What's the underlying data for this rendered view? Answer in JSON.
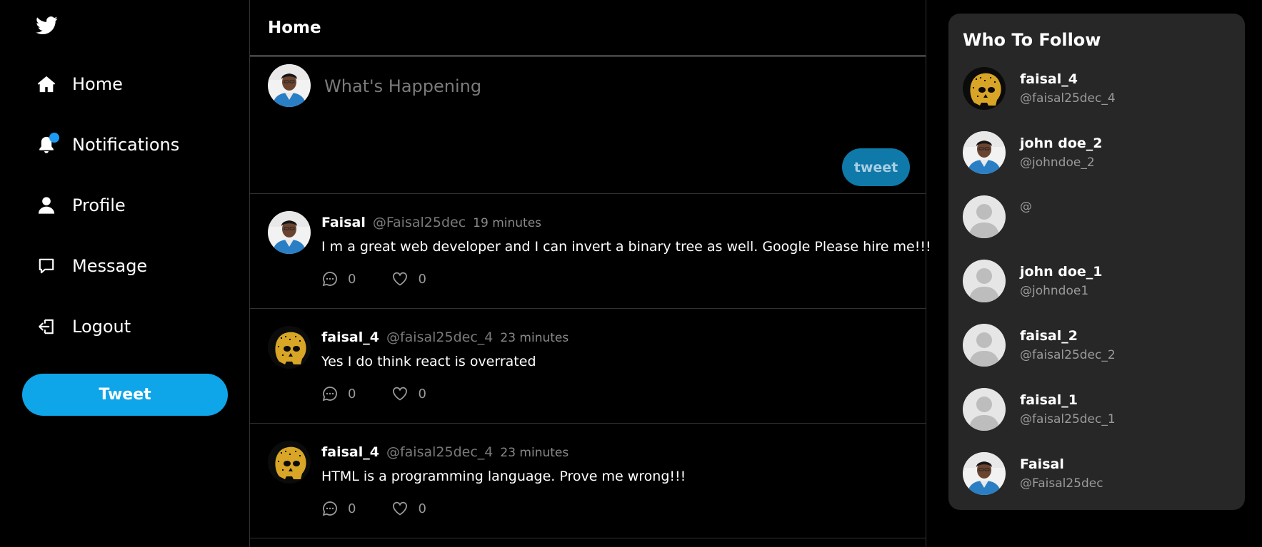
{
  "nav": {
    "logo": "twitter-bird-icon",
    "items": [
      {
        "label": "Home",
        "icon": "home-icon"
      },
      {
        "label": "Notifications",
        "icon": "bell-icon"
      },
      {
        "label": "Profile",
        "icon": "user-icon"
      },
      {
        "label": "Message",
        "icon": "message-icon"
      },
      {
        "label": "Logout",
        "icon": "logout-icon"
      }
    ],
    "tweet_button": "Tweet"
  },
  "main": {
    "title": "Home",
    "compose": {
      "placeholder": "What's Happening",
      "submit_label": "tweet"
    },
    "tweets": [
      {
        "name": "Faisal",
        "handle": "@Faisal25dec",
        "time": "19 minutes",
        "text": "I m a great web developer and I can invert a binary tree as well. Google Please hire me!!!",
        "comments": "0",
        "likes": "0"
      },
      {
        "name": "faisal_4",
        "handle": "@faisal25dec_4",
        "time": "23 minutes",
        "text": "Yes I do think react is overrated",
        "comments": "0",
        "likes": "0"
      },
      {
        "name": "faisal_4",
        "handle": "@faisal25dec_4",
        "time": "23 minutes",
        "text": "HTML is a programming language. Prove me wrong!!!",
        "comments": "0",
        "likes": "0"
      }
    ]
  },
  "who_to_follow": {
    "title": "Who To Follow",
    "users": [
      {
        "name": "faisal_4",
        "handle": "@faisal25dec_4"
      },
      {
        "name": "john doe_2",
        "handle": "@johndoe_2"
      },
      {
        "name": "",
        "handle": "@"
      },
      {
        "name": "john doe_1",
        "handle": "@johndoe1"
      },
      {
        "name": "faisal_2",
        "handle": "@faisal25dec_2"
      },
      {
        "name": "faisal_1",
        "handle": "@faisal25dec_1"
      },
      {
        "name": "Faisal",
        "handle": "@Faisal25dec"
      }
    ]
  },
  "colors": {
    "accent": "#1d9bf0",
    "tweet_button": "#0ea5e9",
    "compose_button": "#0f79a9",
    "panel_bg": "#272727",
    "page_bg": "#000000"
  }
}
